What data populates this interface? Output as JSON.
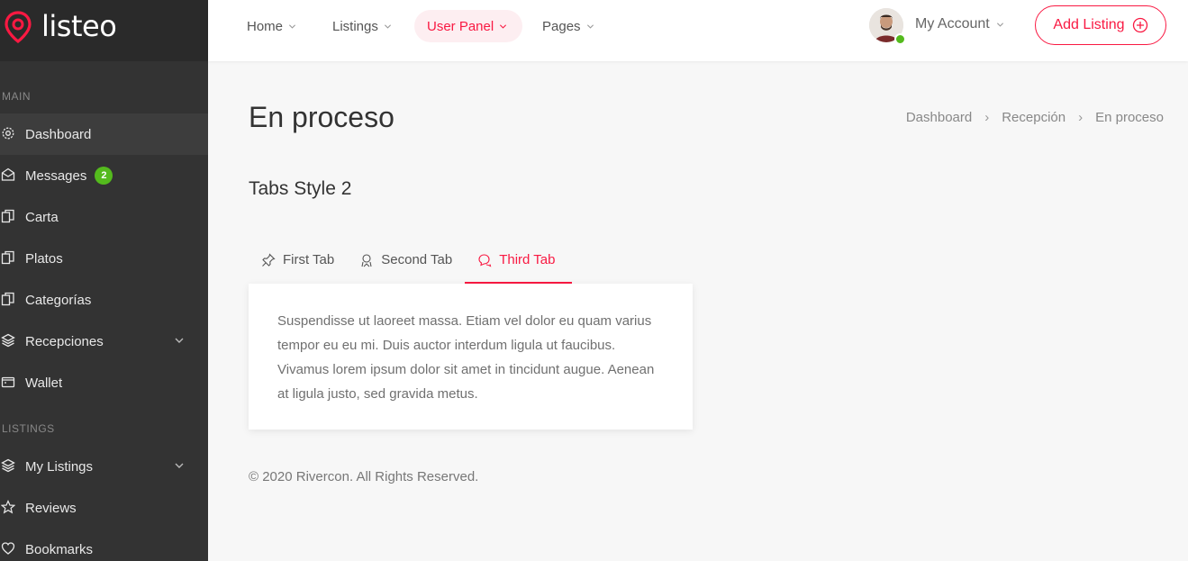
{
  "brand": {
    "name": "listeo"
  },
  "sidebar": {
    "sections": [
      {
        "title": "MAIN",
        "items": [
          {
            "label": "Dashboard",
            "icon": "gear-icon",
            "active": true
          },
          {
            "label": "Messages",
            "icon": "envelope-icon",
            "badge": "2"
          },
          {
            "label": "Carta",
            "icon": "copy-icon"
          },
          {
            "label": "Platos",
            "icon": "copy-icon"
          },
          {
            "label": "Categorías",
            "icon": "copy-icon"
          },
          {
            "label": "Recepciones",
            "icon": "layers-icon",
            "has_submenu": true
          },
          {
            "label": "Wallet",
            "icon": "wallet-icon"
          }
        ]
      },
      {
        "title": "LISTINGS",
        "items": [
          {
            "label": "My Listings",
            "icon": "layers-icon",
            "has_submenu": true
          },
          {
            "label": "Reviews",
            "icon": "star-icon"
          },
          {
            "label": "Bookmarks",
            "icon": "heart-icon"
          }
        ]
      }
    ]
  },
  "header": {
    "menu": [
      {
        "label": "Home"
      },
      {
        "label": "Listings"
      },
      {
        "label": "User Panel",
        "active": true
      },
      {
        "label": "Pages"
      }
    ],
    "account_label": "My Account",
    "add_listing_label": "Add Listing"
  },
  "main": {
    "title": "En proceso",
    "breadcrumb": [
      "Dashboard",
      "Recepción",
      "En proceso"
    ],
    "section_title": "Tabs Style 2",
    "tabs": [
      {
        "label": "First Tab",
        "icon": "pin-icon"
      },
      {
        "label": "Second Tab",
        "icon": "user-icon"
      },
      {
        "label": "Third Tab",
        "icon": "chat-icon",
        "active": true
      }
    ],
    "tab_content": "Suspendisse ut laoreet massa. Etiam vel dolor eu quam varius tempor eu eu mi. Duis auctor interdum ligula ut faucibus. Vivamus lorem ipsum dolor sit amet in tincidunt augue. Aenean at ligula justo, sed gravida metus."
  },
  "footer": {
    "text": "© 2020 Rivercon. All Rights Reserved."
  },
  "colors": {
    "accent": "#f91942",
    "sidebar_bg": "#333333",
    "badge": "#54ba1d"
  }
}
